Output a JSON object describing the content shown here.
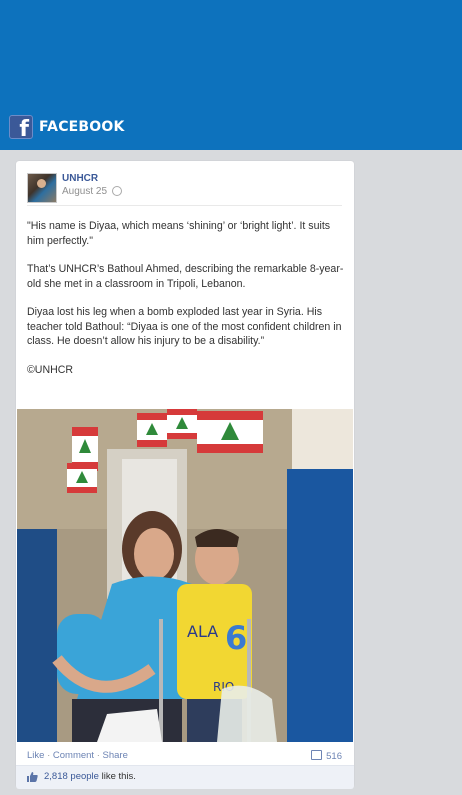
{
  "header": {
    "title": "FACEBOOK",
    "logo_letter": "f",
    "color": "#0d72bd"
  },
  "post": {
    "author": "UNHCR",
    "date": "August 25",
    "paragraphs": [
      "\"His name is Diyaa, which means ‘shining’ or ‘bright light’. It suits him perfectly.\"",
      "That’s UNHCR’s Bathoul Ahmed, describing the remarkable 8-year-old she met in a classroom in Tripoli, Lebanon.",
      "Diyaa lost his leg when a bomb exploded last year in Syria. His teacher told Bathoul: “Diyaa is one of the most confident children in class. He doesn’t allow his injury to be a disability.”",
      "©UNHCR"
    ]
  },
  "photo": {
    "shirt_text_1": "ALA",
    "shirt_number": "6",
    "shirt_text_2": "RIO"
  },
  "actions": {
    "like": "Like",
    "comment": "Comment",
    "share": "Share",
    "separator": "·",
    "comment_count": "516"
  },
  "likes": {
    "count_link": "2,818 people",
    "suffix": " like this."
  }
}
